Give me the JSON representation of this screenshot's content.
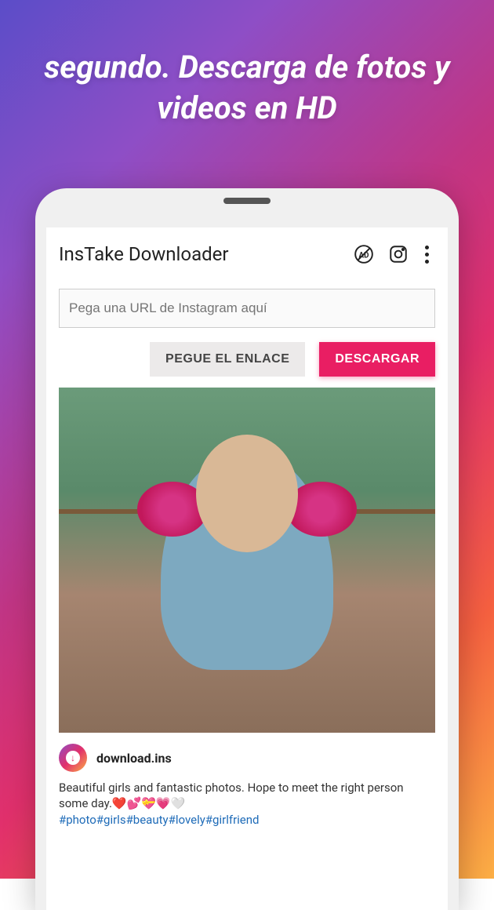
{
  "promo": {
    "headline": "segundo. Descarga de fotos y videos en HD"
  },
  "app": {
    "title": "InsTake Downloader",
    "icons": {
      "no_ads": "no-ads-icon",
      "instagram": "instagram-icon",
      "more": "more-icon"
    },
    "input": {
      "placeholder": "Pega una URL de Instagram aquí"
    },
    "buttons": {
      "paste": "PEGUE EL ENLACE",
      "download": "DESCARGAR"
    },
    "post": {
      "username": "download.ins",
      "caption_line1": "Beautiful girls and fantastic photos. Hope to meet the right person some day.",
      "emoji": "❤️💕💝💗🤍",
      "hashtags": "#photo#girls#beauty#lovely#girlfriend"
    }
  },
  "colors": {
    "primary_button": "#e91e63",
    "link": "#1e6bb8"
  }
}
